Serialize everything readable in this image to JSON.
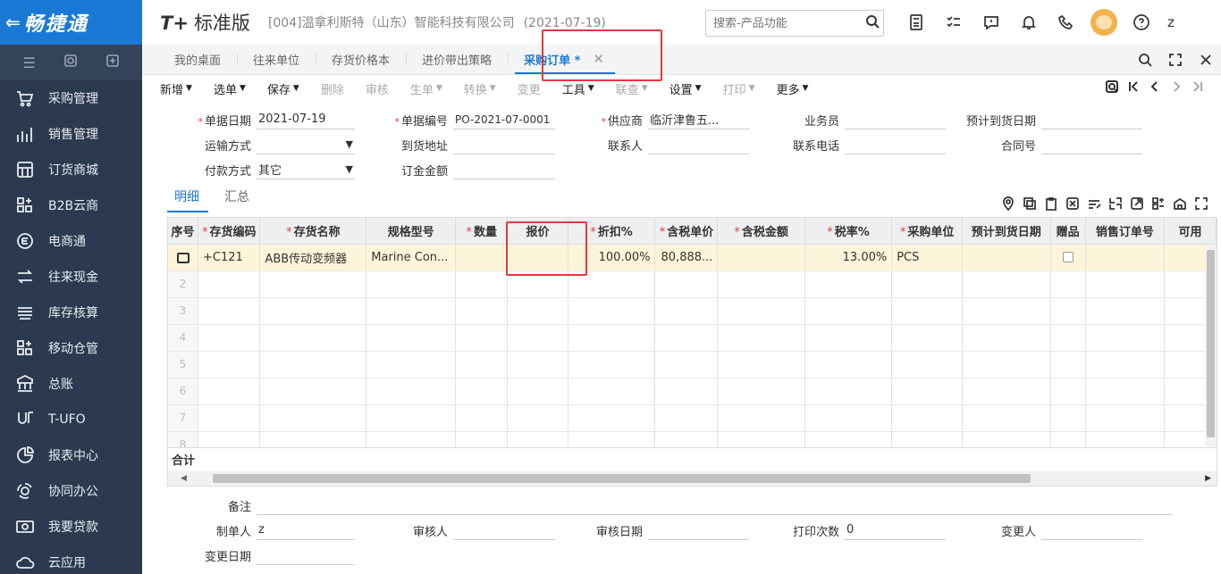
{
  "brand": {
    "back": "⇐",
    "name": "畅捷通"
  },
  "sidebar": {
    "tools": [
      "☰",
      "⌕",
      "⊕"
    ],
    "items": [
      {
        "label": "采购管理",
        "icon": "cart-icon"
      },
      {
        "label": "销售管理",
        "icon": "bar-chart-icon"
      },
      {
        "label": "订货商城",
        "icon": "store-icon"
      },
      {
        "label": "B2B云商",
        "icon": "grid-plus-icon"
      },
      {
        "label": "电商通",
        "icon": "ecommerce-icon"
      },
      {
        "label": "往来现金",
        "icon": "exchange-icon"
      },
      {
        "label": "库存核算",
        "icon": "warehouse-icon"
      },
      {
        "label": "移动仓管",
        "icon": "mobile-warehouse-icon"
      },
      {
        "label": "总账",
        "icon": "ledger-icon"
      },
      {
        "label": "T-UFO",
        "icon": "ufo-icon"
      },
      {
        "label": "报表中心",
        "icon": "pie-chart-icon"
      },
      {
        "label": "协同办公",
        "icon": "collab-icon"
      },
      {
        "label": "我要贷款",
        "icon": "loan-icon"
      },
      {
        "label": "云应用",
        "icon": "cloud-icon"
      }
    ]
  },
  "header": {
    "logo_t": "T",
    "logo_plus": "+",
    "logo_std": "标准版",
    "company": "[004]温拿利斯特（山东）智能科技有限公司",
    "date": "(2021-07-19)",
    "search_placeholder": "搜索-产品功能",
    "user_initial": "z"
  },
  "tabs": [
    {
      "label": "我的桌面"
    },
    {
      "label": "往来单位"
    },
    {
      "label": "存货价格本"
    },
    {
      "label": "进价带出策略"
    },
    {
      "label": "采购订单 *",
      "active": true
    }
  ],
  "toolbar": {
    "buttons": [
      {
        "label": "新增",
        "dropdown": true,
        "disabled": false
      },
      {
        "label": "选单",
        "dropdown": true,
        "disabled": false
      },
      {
        "label": "保存",
        "dropdown": true,
        "disabled": false
      },
      {
        "label": "删除",
        "dropdown": false,
        "disabled": true
      },
      {
        "label": "审核",
        "dropdown": false,
        "disabled": true
      },
      {
        "label": "生单",
        "dropdown": true,
        "disabled": true
      },
      {
        "label": "转换",
        "dropdown": true,
        "disabled": true
      },
      {
        "label": "变更",
        "dropdown": false,
        "disabled": true
      },
      {
        "label": "工具",
        "dropdown": true,
        "disabled": false
      },
      {
        "label": "联查",
        "dropdown": true,
        "disabled": true
      },
      {
        "label": "设置",
        "dropdown": true,
        "disabled": false
      },
      {
        "label": "打印",
        "dropdown": true,
        "disabled": true
      },
      {
        "label": "更多",
        "dropdown": true,
        "disabled": false
      }
    ]
  },
  "form": {
    "doc_date_label": "单据日期",
    "doc_date": "2021-07-19",
    "doc_no_label": "单据编号",
    "doc_no": "PO-2021-07-0001",
    "supplier_label": "供应商",
    "supplier": "临沂津鲁五...",
    "salesman_label": "业务员",
    "salesman": "",
    "expected_date_label": "预计到货日期",
    "expected_date": "",
    "transport_label": "运输方式",
    "transport": "",
    "address_label": "到货地址",
    "address": "",
    "contact_label": "联系人",
    "contact": "",
    "phone_label": "联系电话",
    "phone": "",
    "contract_label": "合同号",
    "contract": "",
    "payment_label": "付款方式",
    "payment": "其它",
    "deposit_label": "订金金额",
    "deposit": ""
  },
  "detail_tabs": [
    "明细",
    "汇总"
  ],
  "grid": {
    "columns": [
      {
        "label": "序号",
        "req": false
      },
      {
        "label": "存货编码",
        "req": true
      },
      {
        "label": "存货名称",
        "req": true
      },
      {
        "label": "规格型号",
        "req": false
      },
      {
        "label": "数量",
        "req": true
      },
      {
        "label": "报价",
        "req": false
      },
      {
        "label": "折扣%",
        "req": true
      },
      {
        "label": "含税单价",
        "req": true
      },
      {
        "label": "含税金额",
        "req": true
      },
      {
        "label": "税率%",
        "req": true
      },
      {
        "label": "采购单位",
        "req": true
      },
      {
        "label": "预计到货日期",
        "req": false
      },
      {
        "label": "赠品",
        "req": false
      },
      {
        "label": "销售订单号",
        "req": false
      },
      {
        "label": "可用",
        "req": false
      }
    ],
    "rows": [
      {
        "code": "+C121",
        "name": "ABB传动变频器",
        "spec": "Marine Con...",
        "qty": "",
        "quote": "",
        "discount": "100.00%",
        "price": "80,888...",
        "amount": "",
        "tax": "13.00%",
        "unit": "PCS",
        "date": "",
        "so": "",
        "avail": ""
      }
    ],
    "empty_row_numbers": [
      "2",
      "3",
      "4",
      "5",
      "6",
      "7",
      "8"
    ],
    "total_label": "合计"
  },
  "footer": {
    "remark_label": "备注",
    "remark": "",
    "creator_label": "制单人",
    "creator": "z",
    "auditor_label": "审核人",
    "auditor": "",
    "audit_date_label": "审核日期",
    "audit_date": "",
    "print_count_label": "打印次数",
    "print_count": "0",
    "changer_label": "变更人",
    "changer": "",
    "change_date_label": "变更日期",
    "change_date": ""
  }
}
